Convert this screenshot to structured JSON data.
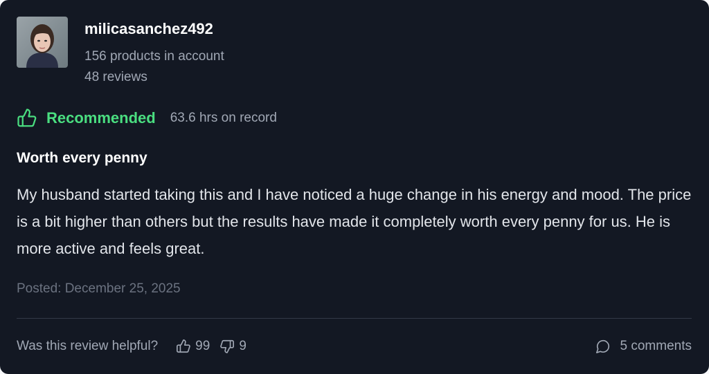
{
  "reviewer": {
    "username": "milicasanchez492",
    "products": "156 products in account",
    "reviews": "48 reviews"
  },
  "recommendation": {
    "label": "Recommended",
    "hours": "63.6 hrs on record",
    "color": "#4ade80",
    "icon": "thumbs-up-icon"
  },
  "review": {
    "title": "Worth every penny",
    "body": "My husband started taking this and I have noticed a huge change in his energy and mood. The price is a bit higher than others but the results have made it completely worth every penny for us. He is more active and feels great.",
    "posted": "Posted: December 25, 2025"
  },
  "footer": {
    "helpful_question": "Was this review helpful?",
    "upvotes": "99",
    "downvotes": "9",
    "comments": "5 comments"
  },
  "colors": {
    "card_background": "#131823",
    "text_primary": "#ffffff",
    "text_secondary": "#a1a8b5",
    "text_muted": "#6b7280",
    "accent_green": "#4ade80"
  }
}
